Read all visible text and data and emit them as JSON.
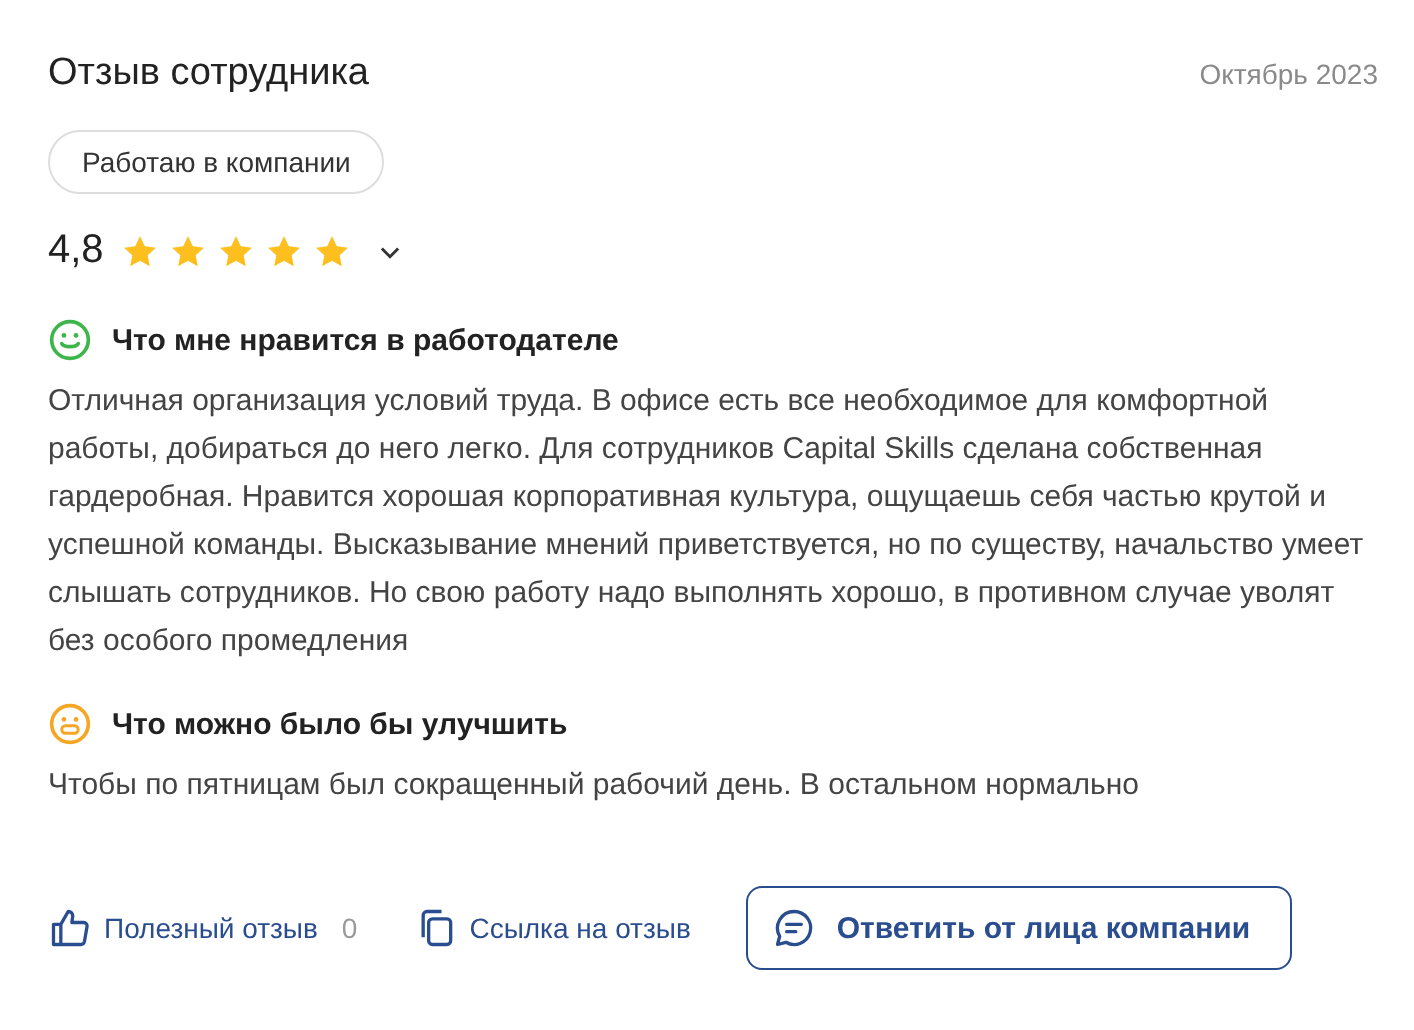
{
  "review": {
    "title": "Отзыв сотрудника",
    "date": "Октябрь 2023",
    "tag": "Работаю в компании",
    "rating": "4,8",
    "stars": 5,
    "expanded": false
  },
  "sections": [
    {
      "kind": "pro",
      "heading": "Что мне нравится в работодателе",
      "text": "Отличная организация условий труда. В офисе есть все необходимое для комфортной работы, добираться до него легко. Для сотрудников Capital Skills сделана собственная гардеробная. Нравится хорошая корпоративная культура, ощущаешь себя частью крутой и успешной команды. Высказывание мнений приветствуется, но по существу, начальство умеет слышать сотрудников. Но свою работу надо выполнять хорошо, в противном случае уволят без особого промедления"
    },
    {
      "kind": "con",
      "heading": "Что можно было бы улучшить",
      "text": "Чтобы по пятницам был сокращенный рабочий день. В остальном нормально"
    }
  ],
  "actions": {
    "helpful": "Полезный отзыв",
    "helpful_count": "0",
    "link": "Ссылка на отзыв",
    "reply": "Ответить от лица компании"
  }
}
